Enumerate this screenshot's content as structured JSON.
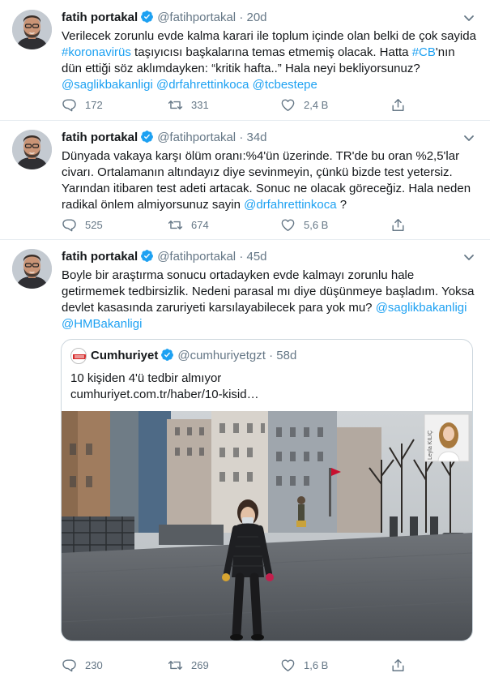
{
  "tweets": [
    {
      "name": "fatih portakal",
      "handle": "@fatihportakal",
      "dot": "·",
      "age": "20d",
      "text": [
        {
          "t": "Verilecek zorunlu evde kalma karari ile toplum içinde olan belki de çok sayida ",
          "link": false
        },
        {
          "t": "#koronavirüs",
          "link": true
        },
        {
          "t": " taşıyıcısı başkalarına temas etmemiş olacak. Hatta ",
          "link": false
        },
        {
          "t": "#CB",
          "link": true
        },
        {
          "t": "'nın dün ettiği söz aklımdayken: “kritik hafta..” Hala neyi bekliyorsunuz? ",
          "link": false
        },
        {
          "t": "@saglikbakanligi",
          "link": true
        },
        {
          "t": " ",
          "link": false
        },
        {
          "t": "@drfahrettinkoca",
          "link": true
        },
        {
          "t": " ",
          "link": false
        },
        {
          "t": "@tcbestepe",
          "link": true
        }
      ],
      "replies": "172",
      "retweets": "331",
      "likes": "2,4 B"
    },
    {
      "name": "fatih portakal",
      "handle": "@fatihportakal",
      "dot": "·",
      "age": "34d",
      "text": [
        {
          "t": "Dünyada vakaya karşı ölüm oranı:%4'ün üzerinde. TR'de bu oran %2,5'lar civarı. Ortalamanın altındayız diye sevinmeyin, çünkü bizde test yetersiz. Yarından itibaren test adeti artacak. Sonuc ne olacak göreceğiz. Hala neden radikal önlem almiyorsunuz sayin ",
          "link": false
        },
        {
          "t": "@drfahrettinkoca",
          "link": true
        },
        {
          "t": " ?",
          "link": false
        }
      ],
      "replies": "525",
      "retweets": "674",
      "likes": "5,6 B"
    },
    {
      "name": "fatih portakal",
      "handle": "@fatihportakal",
      "dot": "·",
      "age": "45d",
      "text": [
        {
          "t": "Boyle bir araştırma sonucu ortadayken evde kalmayı zorunlu hale getirmemek tedbirsizlik. Nedeni parasal mı diye düşünmeye başladım. Yoksa devlet kasasında zaruriyeti karsılayabilecek para yok mu? ",
          "link": false
        },
        {
          "t": "@saglikbakanligi",
          "link": true
        },
        {
          "t": " ",
          "link": false
        },
        {
          "t": "@HMBakanligi",
          "link": true
        }
      ],
      "replies": "230",
      "retweets": "269",
      "likes": "1,6 B",
      "quote": {
        "name": "Cumhuriyet",
        "handle": "@cumhuriyetgzt",
        "dot": "·",
        "age": "58d",
        "text": "10 kişiden 4'ü tedbir almıyor",
        "link": "cumhuriyet.com.tr/haber/10-kisid…",
        "photo_credit": "Leyla KILIÇ"
      }
    }
  ],
  "icons": {
    "verified": "verified-badge-icon",
    "menu": "chevron-down-icon",
    "reply": "reply-icon",
    "retweet": "retweet-icon",
    "like": "heart-icon",
    "share": "share-icon"
  },
  "colors": {
    "accent": "#1da1f2",
    "muted": "#657786",
    "text": "#14171a",
    "border": "#e6ecf0"
  }
}
